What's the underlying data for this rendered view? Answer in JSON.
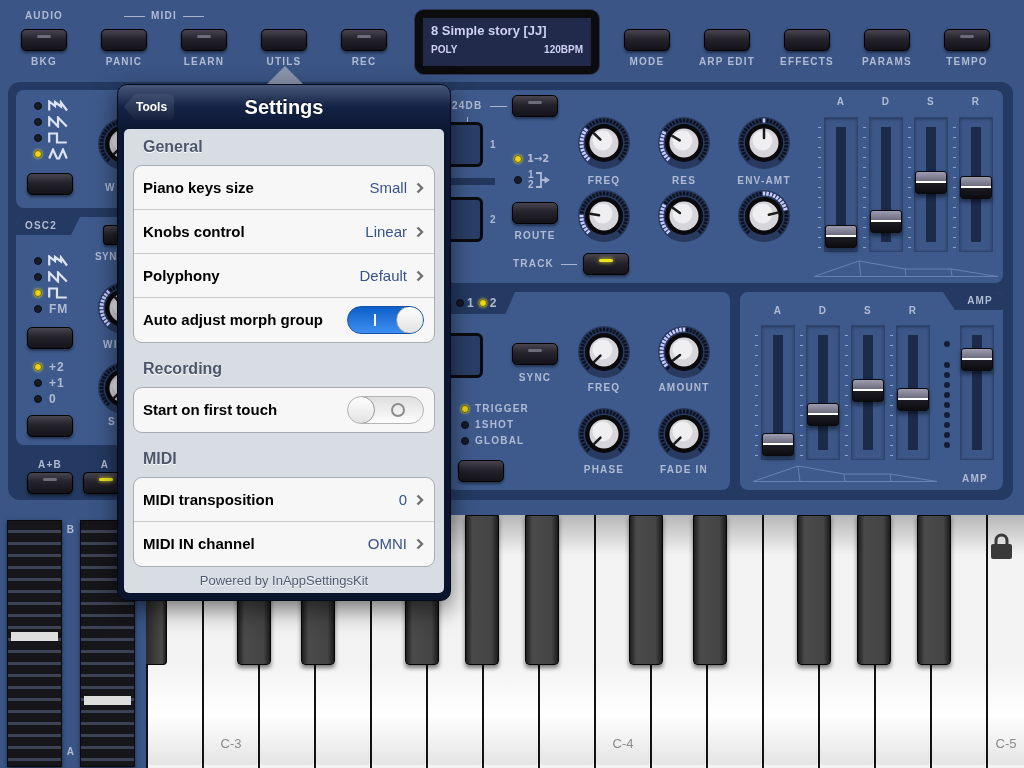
{
  "top_bar": {
    "group_labels": [
      {
        "kind": "plain",
        "text": "AUDIO"
      },
      {
        "kind": "ruled",
        "text": "MIDI"
      }
    ],
    "left_buttons": [
      {
        "label": "BKG",
        "lit": false
      },
      {
        "label": "PANIC"
      },
      {
        "label": "LEARN",
        "lit": false
      },
      {
        "label": "UTILS"
      },
      {
        "label": "REC",
        "lit": false
      }
    ],
    "display": {
      "patch": "8 Simple story [JJ]",
      "mode": "POLY",
      "tempo": "120BPM"
    },
    "right_buttons": [
      {
        "label": "MODE"
      },
      {
        "label": "ARP EDIT"
      },
      {
        "label": "EFFECTS"
      },
      {
        "label": "PARAMS"
      },
      {
        "label": "TEMPO",
        "lit": false
      }
    ]
  },
  "osc1": {
    "waveforms": [
      {
        "kind": "ramp",
        "selected": false
      },
      {
        "kind": "saw",
        "selected": false
      },
      {
        "kind": "square",
        "selected": false
      },
      {
        "kind": "triangle",
        "selected": true
      }
    ],
    "knob_label": "W"
  },
  "osc2": {
    "tab": "OSC2",
    "sync_label": "SYN",
    "waveforms": [
      {
        "kind": "ramp",
        "selected": false
      },
      {
        "kind": "saw",
        "selected": false
      },
      {
        "kind": "square",
        "selected": true
      },
      {
        "kind": "text",
        "label": "FM",
        "selected": false
      }
    ],
    "knob_1_label": "WI",
    "octaves": [
      {
        "label": "+2",
        "selected": true
      },
      {
        "label": "+1",
        "selected": false
      },
      {
        "label": "0",
        "selected": false
      }
    ],
    "knob_2_label": "S"
  },
  "mix": [
    {
      "label": "A+B",
      "lit": false
    },
    {
      "label": "A",
      "lit": true
    }
  ],
  "filter": {
    "slope": {
      "label": "24DB",
      "lit": false
    },
    "display_labels": [
      "1",
      "2"
    ],
    "routing": [
      {
        "kind": "serial",
        "label": "1→2",
        "selected": true
      },
      {
        "kind": "parallel",
        "labels": [
          "1",
          "2"
        ],
        "selected": false
      }
    ],
    "route_label": "ROUTE",
    "knob_labels": [
      "FREQ",
      "RES",
      "ENV-AMT"
    ],
    "track": {
      "label": "TRACK",
      "lit": true
    },
    "sliders": [
      {
        "label": "A",
        "level": 0.03
      },
      {
        "label": "D",
        "level": 0.16
      },
      {
        "label": "S",
        "level": 0.52
      },
      {
        "label": "R",
        "level": 0.47
      }
    ]
  },
  "lfo": {
    "selectors": [
      {
        "label": "1",
        "selected": false
      },
      {
        "label": "2",
        "selected": true
      }
    ],
    "sync": {
      "label": "SYNC",
      "lit": false
    },
    "modes": [
      {
        "label": "TRIGGER",
        "selected": true
      },
      {
        "label": "1SHOT",
        "selected": false
      },
      {
        "label": "GLOBAL",
        "selected": false
      }
    ],
    "knob_labels": [
      "FREQ",
      "AMOUNT",
      "PHASE",
      "FADE IN"
    ]
  },
  "amp": {
    "tab": "AMP",
    "sliders": [
      {
        "label": "A",
        "level": 0.03
      },
      {
        "label": "D",
        "level": 0.3
      },
      {
        "label": "S",
        "level": 0.52
      },
      {
        "label": "R",
        "level": 0.44
      }
    ],
    "volume": {
      "level": 0.8
    },
    "volume_label": "AMP"
  },
  "keyboard": {
    "strip_labels": [
      "B",
      "A"
    ],
    "strips": [
      {
        "level": 0.53
      },
      {
        "level": 0.27
      }
    ],
    "octave_labels": [
      "C-3",
      "C-4",
      "C-5"
    ]
  },
  "settings": {
    "back_button": "Tools",
    "title": "Settings",
    "sections": [
      {
        "header": "General",
        "rows": [
          {
            "kind": "choice",
            "label": "Piano keys size",
            "value": "Small"
          },
          {
            "kind": "choice",
            "label": "Knobs control",
            "value": "Linear"
          },
          {
            "kind": "choice",
            "label": "Polyphony",
            "value": "Default"
          },
          {
            "kind": "toggle",
            "label": "Auto adjust morph group",
            "on": true
          }
        ]
      },
      {
        "header": "Recording",
        "rows": [
          {
            "kind": "toggle",
            "label": "Start on first touch",
            "on": false
          }
        ]
      },
      {
        "header": "MIDI",
        "rows": [
          {
            "kind": "choice",
            "label": "MIDI transposition",
            "value": "0"
          },
          {
            "kind": "choice",
            "label": "MIDI IN channel",
            "value": "OMNI"
          }
        ]
      }
    ],
    "footer": "Powered by InAppSettingsKit"
  }
}
